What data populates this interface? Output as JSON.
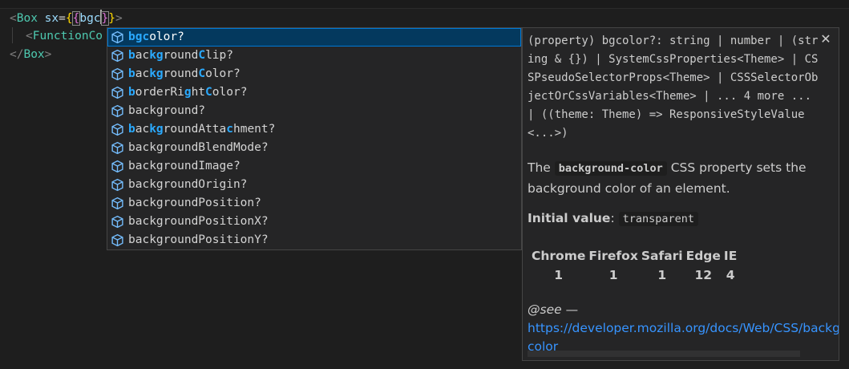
{
  "editor": {
    "line1": {
      "open": "<",
      "tag": "Box",
      "attr": "sx",
      "eq": "=",
      "brace_open": "{",
      "brace_open2": "{",
      "typed": "bgc",
      "brace_close2": "}",
      "brace_close": "}",
      "close": ">"
    },
    "line2": {
      "open": "<",
      "tag": "FunctionCo"
    },
    "line3": {
      "open": "</",
      "tag": "Box",
      "close": ">"
    }
  },
  "suggestions": [
    {
      "hl": "bgc",
      "rest": "olor?",
      "selected": true
    },
    {
      "parts": [
        [
          "b",
          1
        ],
        [
          "ac",
          0
        ],
        [
          "kg",
          1
        ],
        [
          "round",
          0
        ],
        [
          "C",
          1
        ],
        [
          "lip?",
          0
        ]
      ]
    },
    {
      "parts": [
        [
          "b",
          1
        ],
        [
          "ac",
          0
        ],
        [
          "kg",
          1
        ],
        [
          "round",
          0
        ],
        [
          "C",
          1
        ],
        [
          "olor?",
          0
        ]
      ]
    },
    {
      "parts": [
        [
          "b",
          1
        ],
        [
          "orderRi",
          0
        ],
        [
          "g",
          1
        ],
        [
          "ht",
          0
        ],
        [
          "C",
          1
        ],
        [
          "olor?",
          0
        ]
      ]
    },
    {
      "parts": [
        [
          "background?",
          0
        ]
      ]
    },
    {
      "parts": [
        [
          "b",
          1
        ],
        [
          "ac",
          0
        ],
        [
          "kg",
          1
        ],
        [
          "roundAtta",
          0
        ],
        [
          "c",
          1
        ],
        [
          "hment?",
          0
        ]
      ]
    },
    {
      "parts": [
        [
          "backgroundBlendMode?",
          0
        ]
      ]
    },
    {
      "parts": [
        [
          "backgroundImage?",
          0
        ]
      ]
    },
    {
      "parts": [
        [
          "backgroundOrigin?",
          0
        ]
      ]
    },
    {
      "parts": [
        [
          "backgroundPosition?",
          0
        ]
      ]
    },
    {
      "parts": [
        [
          "backgroundPositionX?",
          0
        ]
      ]
    },
    {
      "parts": [
        [
          "backgroundPositionY?",
          0
        ]
      ]
    }
  ],
  "details": {
    "signature": "(property) bgcolor?: string | number | (string & {}) | SystemCssProperties<Theme> | CSSPseudoSelectorProps<Theme> | CSSSelectorObjectOrCssVariables<Theme> | ... 4 more ... | ((theme: Theme) => ResponsiveStyleValue<...>)",
    "close_glyph": "✕",
    "desc_pre": "The ",
    "desc_code": "background-color",
    "desc_post": " CSS property sets the background color of an element.",
    "initial_label": "Initial value",
    "initial_colon": ": ",
    "initial_value": "transparent",
    "compat_headers": [
      "Chrome",
      "Firefox",
      "Safari",
      "Edge",
      "IE"
    ],
    "compat_values": [
      "1",
      "1",
      "1",
      "12",
      "4"
    ],
    "see_label": "@see",
    "see_dash": " —",
    "see_link_line1": "https://developer.mozilla.org/docs/Web/CSS/background-",
    "see_link_line2": "color"
  },
  "icons": {
    "suggestion": "cube-icon",
    "close": "close-icon"
  },
  "colors": {
    "selected_bg": "#04395e",
    "highlight": "#2aaaff",
    "tag": "#4ec9b0",
    "link": "#3794ff"
  }
}
